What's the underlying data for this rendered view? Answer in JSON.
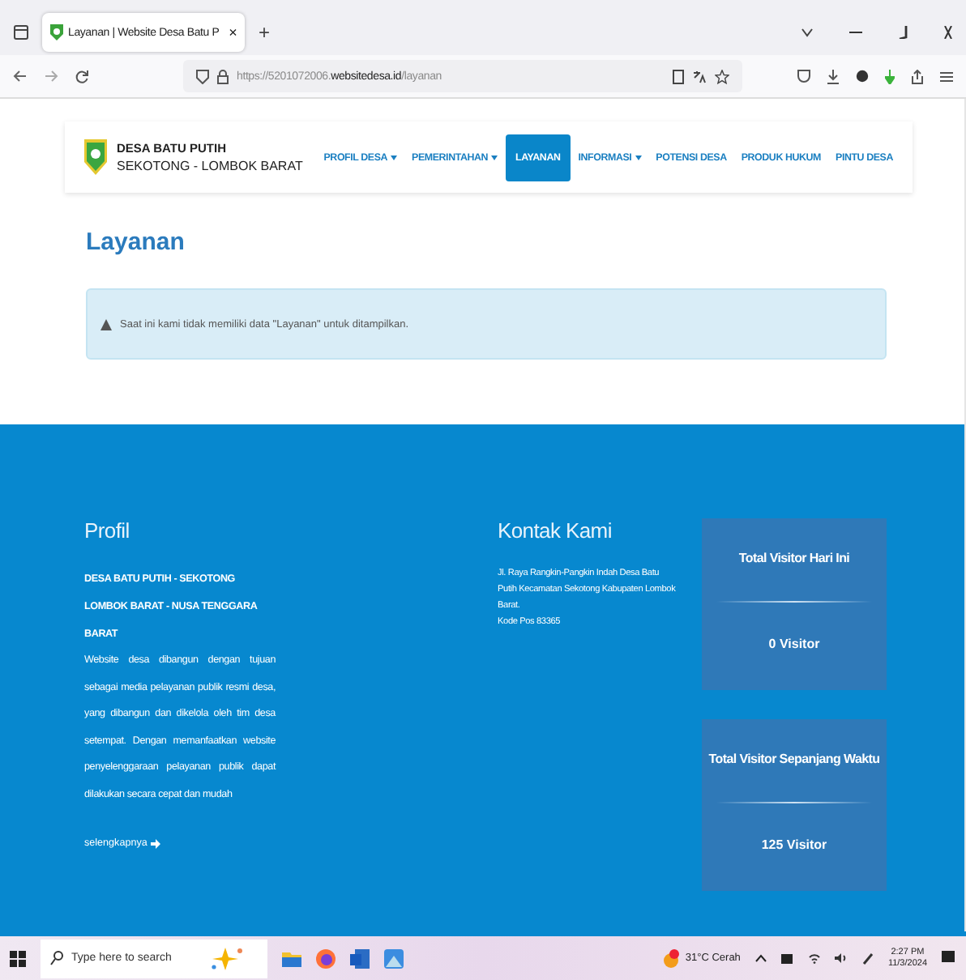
{
  "browser": {
    "tabs": [
      {
        "title": "Layanan | Website Desa Batu P",
        "close": "×",
        "selected": true
      }
    ],
    "new_tab": "+",
    "url": {
      "scheme": "https://5201072006.",
      "domain": "websitedesa.id",
      "path": "/layanan"
    }
  },
  "site": {
    "name": "DESA BATU PUTIH",
    "subtitle": "SEKOTONG - LOMBOK BARAT",
    "nav": [
      {
        "label": "PROFIL DESA",
        "dropdown": true,
        "selected": false
      },
      {
        "label": "PEMERINTAHAN",
        "dropdown": true,
        "selected": false
      },
      {
        "label": "LAYANAN",
        "dropdown": false,
        "selected": true
      },
      {
        "label": "INFORMASI",
        "dropdown": true,
        "selected": false
      },
      {
        "label": "POTENSI DESA",
        "dropdown": false,
        "selected": false
      },
      {
        "label": "PRODUK HUKUM",
        "dropdown": false,
        "selected": false
      },
      {
        "label": "PINTU DESA",
        "dropdown": false,
        "selected": false
      }
    ]
  },
  "page": {
    "heading": "Layanan",
    "alert": "Saat ini kami tidak memiliki data \"Layanan\" untuk ditampilkan."
  },
  "footer": {
    "profile": {
      "title": "Profil",
      "name": "DESA BATU PUTIH - SEKOTONG LOMBOK BARAT - NUSA TENGGARA BARAT",
      "text": "Website desa dibangun dengan tujuan sebagai media pelayanan publik resmi desa, yang dibangun dan dikelola oleh tim desa setempat. Dengan memanfaatkan website penyelenggaraan pelayanan publik dapat dilakukan secara cepat dan mudah",
      "link": "selengkapnya"
    },
    "contact": {
      "title": "Kontak Kami",
      "address": "Jl. Raya Rangkin-Pangkin Indah Desa Batu Putih Kecamatan Sekotong Kabupaten Lombok Barat.",
      "postal": "Kode Pos 83365"
    },
    "stats": [
      {
        "label": "Total Visitor Hari Ini",
        "value": "0 Visitor"
      },
      {
        "label": "Total Visitor Sepanjang Waktu",
        "value": "125 Visitor"
      }
    ]
  },
  "taskbar": {
    "search_placeholder": "Type here to search",
    "weather": "31°C Cerah",
    "time": "2:27 PM",
    "date": "11/3/2024"
  }
}
